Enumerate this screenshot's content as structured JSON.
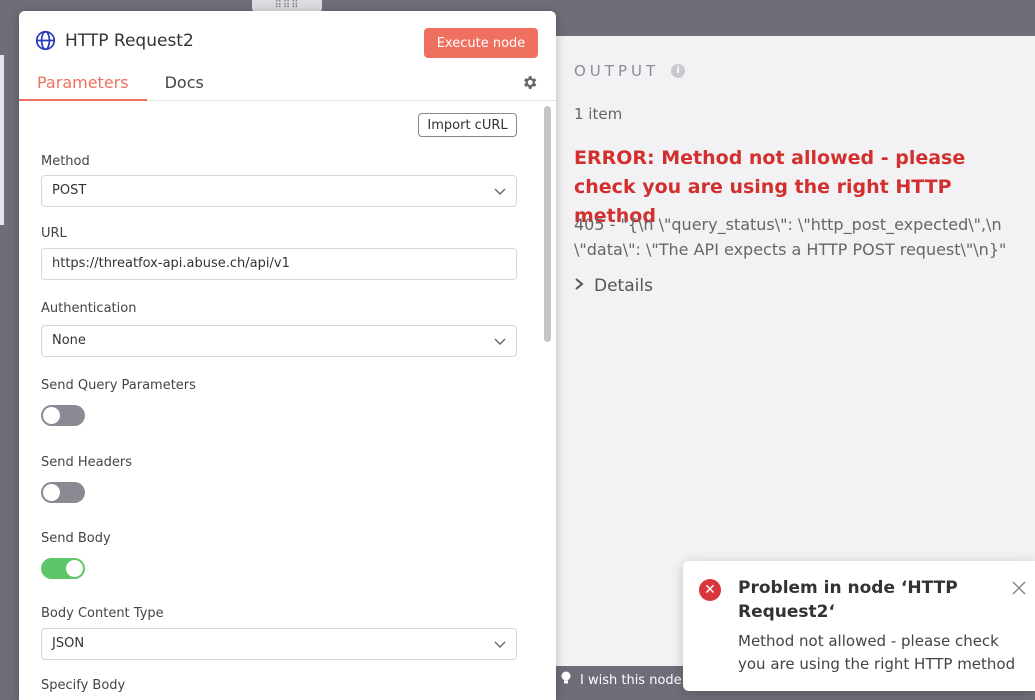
{
  "node": {
    "title": "HTTP Request2",
    "execute_label": "Execute node",
    "tabs": [
      "Parameters",
      "Docs"
    ],
    "import_curl_label": "Import cURL",
    "fields": {
      "method": {
        "label": "Method",
        "value": "POST"
      },
      "url": {
        "label": "URL",
        "value": "https://threatfox-api.abuse.ch/api/v1"
      },
      "authentication": {
        "label": "Authentication",
        "value": "None"
      },
      "send_query": {
        "label": "Send Query Parameters",
        "enabled": false
      },
      "send_headers": {
        "label": "Send Headers",
        "enabled": false
      },
      "send_body": {
        "label": "Send Body",
        "enabled": true
      },
      "body_content_type": {
        "label": "Body Content Type",
        "value": "JSON"
      },
      "specify_body": {
        "label": "Specify Body"
      }
    }
  },
  "output": {
    "heading": "OUTPUT",
    "item_count": "1 item",
    "error_title": "ERROR: Method not allowed - please check you are using the right HTTP method",
    "error_description": "405 - \"{\\n \\\"query_status\\\": \\\"http_post_expected\\\",\\n \\\"data\\\": \\\"The API expects a HTTP POST request\\\"\\n}\"",
    "details_label": "Details"
  },
  "wish_bar": {
    "text": "I wish this node"
  },
  "toast": {
    "title": "Problem in node ‘HTTP Request2‘",
    "message": "Method not allowed - please check you are using the right HTTP method"
  },
  "colors": {
    "accent": "#ee7160",
    "error": "#d2302f",
    "toggle_on": "#5cc668",
    "toggle_off": "#8a8a93",
    "canvas": "#6e6d78"
  },
  "icons": [
    "globe-icon",
    "gear-icon",
    "info-icon",
    "chevron-right-icon",
    "chevron-down-icon",
    "lightbulb-icon",
    "error-circle-icon",
    "close-icon"
  ]
}
